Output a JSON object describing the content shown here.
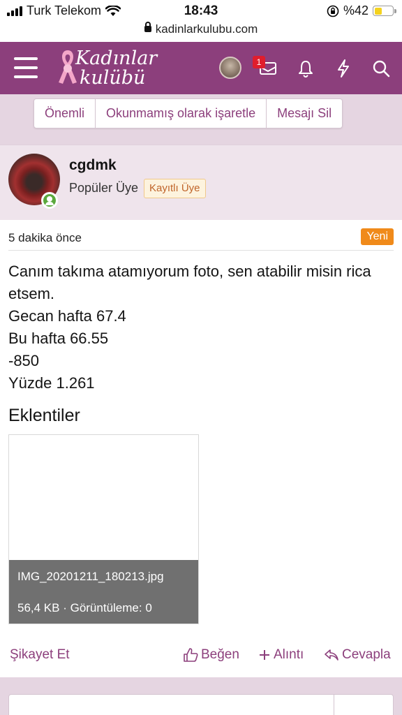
{
  "status_bar": {
    "carrier": "Turk Telekom",
    "time": "18:43",
    "battery": "%42",
    "battery_level": 0.42
  },
  "browser": {
    "url": "kadinlarkulubu.com"
  },
  "header": {
    "logo_line1": "Kadınlar",
    "logo_line2": "kulübü",
    "inbox_badge": "1",
    "icons": [
      "menu-icon",
      "avatar",
      "inbox-icon",
      "bell-icon",
      "lightning-icon",
      "search-icon"
    ]
  },
  "actions": {
    "important": "Önemli",
    "mark_unread": "Okunmamış olarak işaretle",
    "delete": "Mesajı Sil"
  },
  "post": {
    "username": "cgdmk",
    "user_title": "Popüler Üye",
    "user_banner": "Kayıtlı Üye",
    "time": "5 dakika önce",
    "new_label": "Yeni",
    "lines": [
      "Canım takıma atamıyorum foto, sen atabilir misin rica etsem.",
      "Gecan hafta 67.4",
      "Bu hafta 66.55",
      "-850",
      "Yüzde 1.261"
    ],
    "attachments_title": "Eklentiler",
    "attachment": {
      "filename": "IMG_20201211_180213.jpg",
      "meta": "56,4 KB · Görüntüleme: 0"
    },
    "footer": {
      "report": "Şikayet Et",
      "like": "Beğen",
      "quote": "Alıntı",
      "reply": "Cevapla"
    }
  },
  "colors": {
    "brand": "#8c3f7c",
    "new_badge": "#f08a1a",
    "online": "#5aa83c"
  }
}
